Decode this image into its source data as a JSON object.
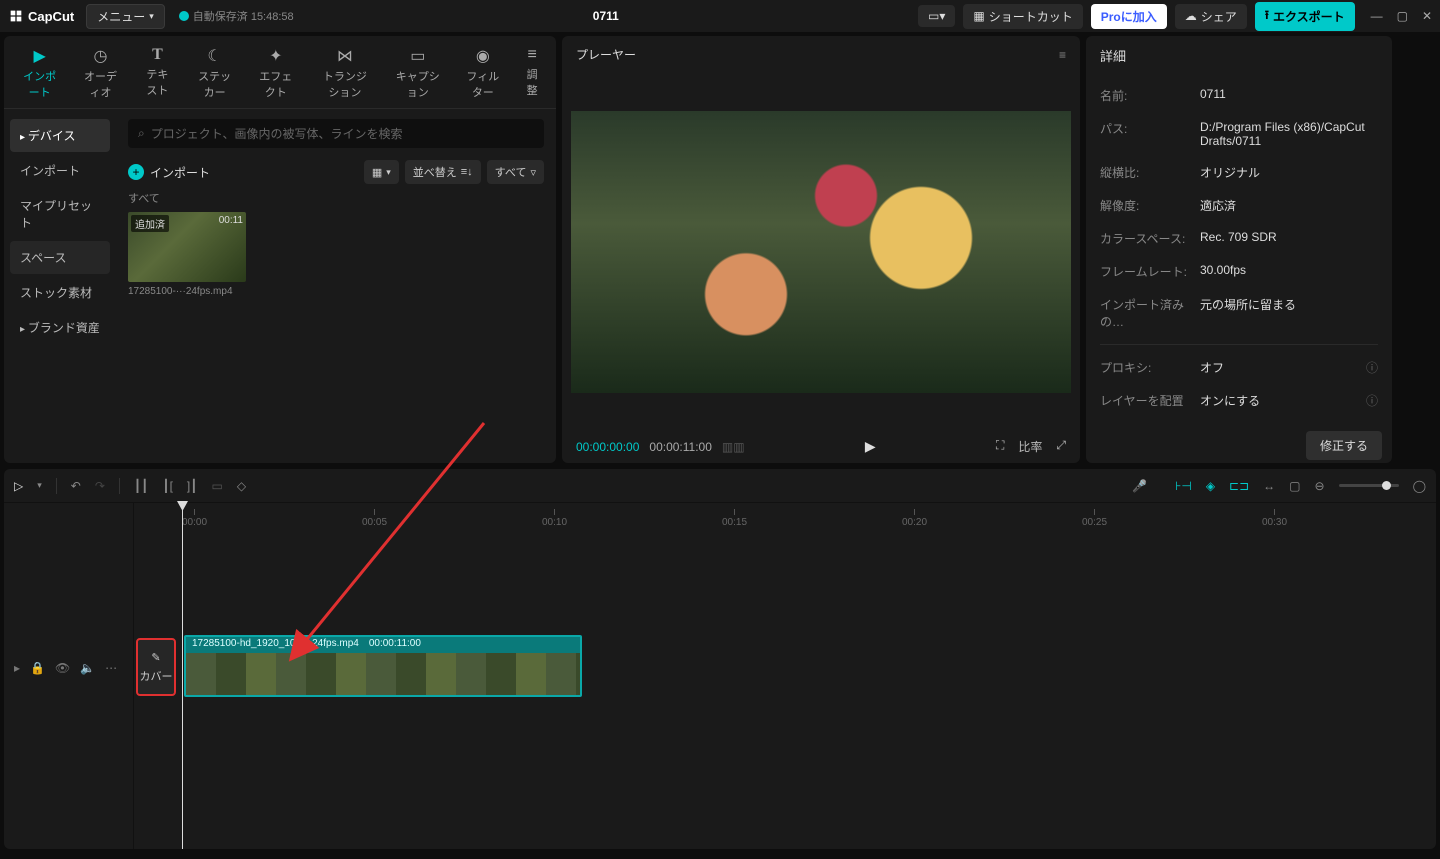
{
  "app": {
    "name": "CapCut",
    "menu": "メニュー",
    "autosave": "自動保存済  15:48:58",
    "project": "0711"
  },
  "titlebar": {
    "shortcut": "ショートカット",
    "pro": "Proに加入",
    "share": "シェア",
    "export": "エクスポート"
  },
  "tabs": {
    "import": "インポート",
    "audio": "オーディオ",
    "text": "テキスト",
    "sticker": "ステッカー",
    "effect": "エフェクト",
    "transition": "トランジション",
    "caption": "キャプション",
    "filter": "フィルター",
    "adjust": "調整"
  },
  "sidenav": {
    "device": "デバイス",
    "import": "インポート",
    "preset": "マイプリセット",
    "space": "スペース",
    "stock": "ストック素材",
    "brand": "ブランド資産"
  },
  "media": {
    "search_placeholder": "プロジェクト、画像内の被写体、ラインを検索",
    "import_btn": "インポート",
    "sort": "並べ替え",
    "all": "すべて",
    "all_filter": "すべて",
    "thumb_badge": "追加済",
    "thumb_dur": "00:11",
    "thumb_name": "17285100-···24fps.mp4"
  },
  "player": {
    "title": "プレーヤー",
    "tc_current": "00:00:00:00",
    "tc_duration": "00:00:11:00"
  },
  "details": {
    "title": "詳細",
    "rows": {
      "name_k": "名前:",
      "name_v": "0711",
      "path_k": "パス:",
      "path_v": "D:/Program Files (x86)/CapCut Drafts/0711",
      "ratio_k": "縦横比:",
      "ratio_v": "オリジナル",
      "res_k": "解像度:",
      "res_v": "適応済",
      "cspace_k": "カラースペース:",
      "cspace_v": "Rec. 709 SDR",
      "fps_k": "フレームレート:",
      "fps_v": "30.00fps",
      "imported_k": "インポート済みの…",
      "imported_v": "元の場所に留まる",
      "proxy_k": "プロキシ:",
      "proxy_v": "オフ",
      "layer_k": "レイヤーを配置",
      "layer_v": "オンにする"
    },
    "fix": "修正する"
  },
  "timeline": {
    "ticks": [
      "00:00",
      "00:05",
      "00:10",
      "00:15",
      "00:20",
      "00:25",
      "00:30"
    ],
    "cover": "カバー",
    "clip_name": "17285100-hd_1920_1080_24fps.mp4",
    "clip_dur": "00:00:11:00"
  }
}
